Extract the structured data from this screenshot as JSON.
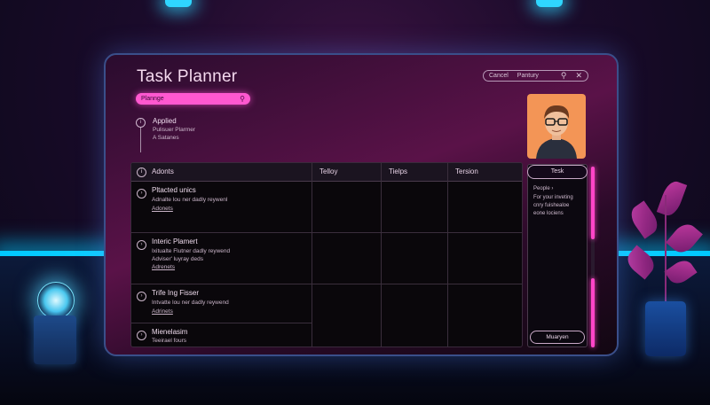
{
  "app": {
    "title": "Task Planner"
  },
  "topbar": {
    "cancel_label": "Cancel",
    "tertiary_label": "Pantury"
  },
  "search": {
    "value": "Plannge"
  },
  "applied": {
    "title": "Applied",
    "line1": "Pulisuer Plarmer",
    "line2": "A Satanes"
  },
  "table": {
    "headers": [
      "Adonts",
      "Telloy",
      "Tielps",
      "Tersion"
    ],
    "rows": [
      {
        "title": "Pltacted unics",
        "desc": "Adnalte lou ner dadly reywenl",
        "link": "Adonets"
      },
      {
        "title": "Interic Plamert",
        "desc": "Ixitualte Flutner dadly reywend",
        "link": "Adviser' luyray deds",
        "link2": "Adrenets"
      },
      {
        "title": "Trife Ing Fisser",
        "desc": "Intvatte lou ner dadly reywend",
        "link": "Adrinets"
      },
      {
        "title": "Mienelasim",
        "desc": "Teeirael fours"
      }
    ]
  },
  "side_panel": {
    "tab_label": "Tesk",
    "people_label": "People",
    "text_lines": [
      "For your inveting",
      "cnry fuishealoe",
      "eone lociens"
    ],
    "bottom_button_label": "Muaryen"
  },
  "colors": {
    "accent": "#ff58d0",
    "floor_glow": "#2fe0ff",
    "avatar_bg": "#f39556"
  }
}
